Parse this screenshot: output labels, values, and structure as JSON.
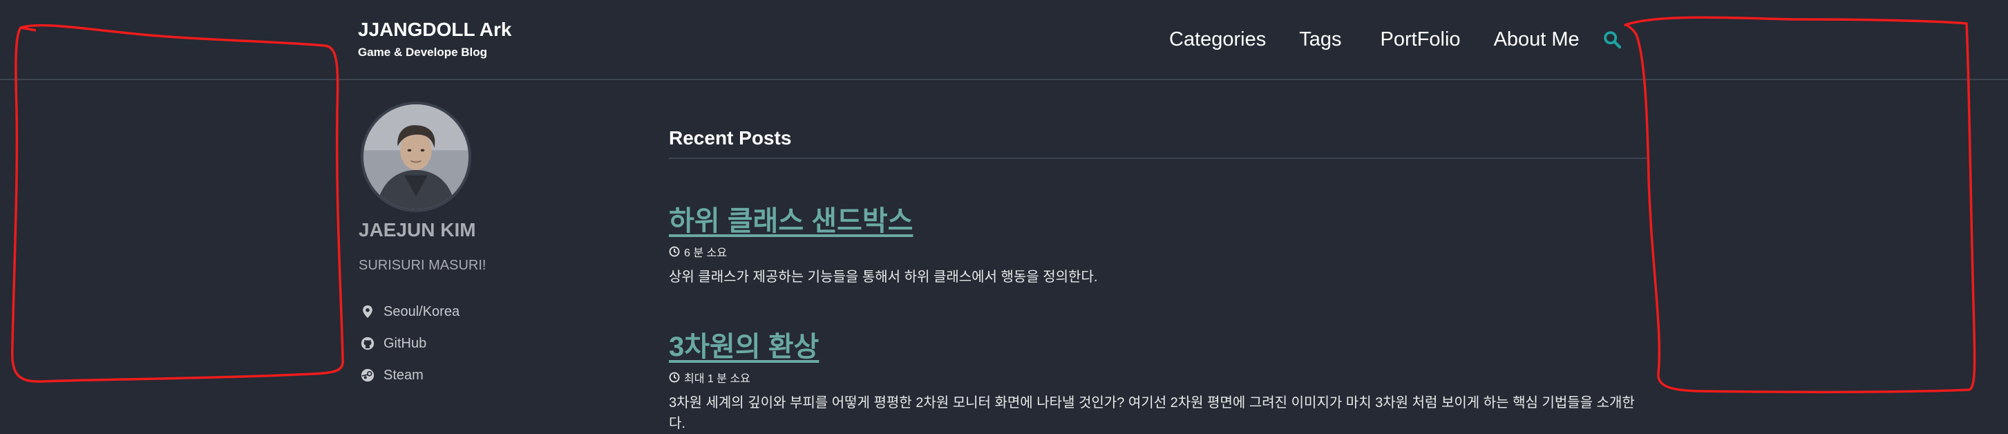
{
  "masthead": {
    "title": "JJANGDOLL Ark",
    "subtitle": "Game & Develope Blog",
    "nav": [
      {
        "label": "Categories"
      },
      {
        "label": "Tags"
      },
      {
        "label": "PortFolio"
      },
      {
        "label": "About Me"
      }
    ],
    "search_icon": "search-icon",
    "accent_color": "#1ea3a3"
  },
  "author": {
    "name": "JAEJUN KIM",
    "bio": "SURISURI MASURI!",
    "links": [
      {
        "label": "Seoul/Korea",
        "icon": "location-pin-icon"
      },
      {
        "label": "GitHub",
        "icon": "github-icon"
      },
      {
        "label": "Steam",
        "icon": "steam-icon"
      }
    ]
  },
  "main": {
    "title": "Recent Posts",
    "posts": [
      {
        "title": "하위 클래스 샌드박스",
        "read_time": "6 분 소요",
        "excerpt": "상위 클래스가 제공하는 기능들을 통해서 하위 클래스에서 행동을 정의한다."
      },
      {
        "title": "3차원의 환상",
        "read_time": "최대 1 분 소요",
        "excerpt": "3차원 세계의 깊이와 부피를 어떻게 평평한 2차원 모니터 화면에 나타낼 것인가? 여기선 2차원 평면에 그려진 이미지가 마치 3차원 처럼 보이게 하는 핵심 기법들을 소개한다."
      }
    ]
  },
  "colors": {
    "background": "#252a34",
    "link": "#6aa9a4",
    "annotation": "#ff0000"
  }
}
